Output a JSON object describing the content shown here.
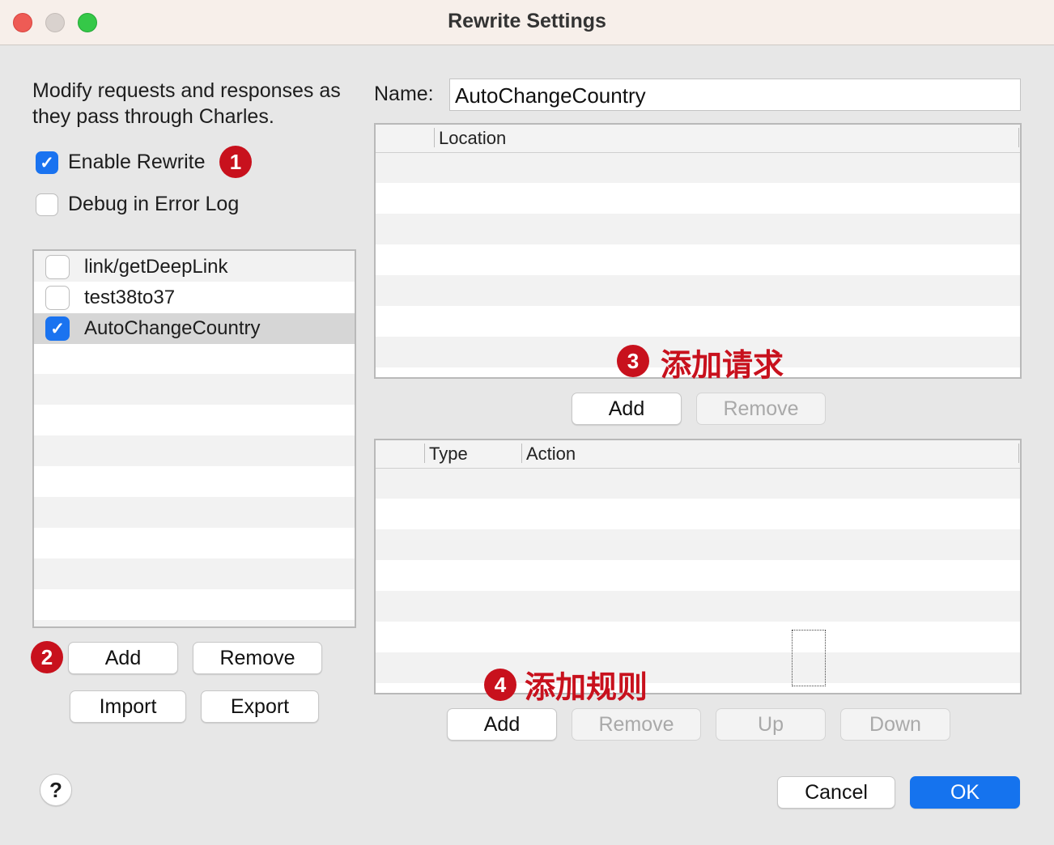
{
  "window": {
    "title": "Rewrite Settings"
  },
  "intro": {
    "text": "Modify requests and responses as they pass through Charles."
  },
  "options": {
    "enable_rewrite": {
      "label": "Enable Rewrite",
      "checked": true
    },
    "debug_log": {
      "label": "Debug in Error Log",
      "checked": false
    }
  },
  "rules": [
    {
      "label": "link/getDeepLink",
      "checked": false,
      "selected": false
    },
    {
      "label": "test38to37",
      "checked": false,
      "selected": false
    },
    {
      "label": "AutoChangeCountry",
      "checked": true,
      "selected": true
    }
  ],
  "rules_buttons": {
    "add": "Add",
    "remove": "Remove",
    "import": "Import",
    "export": "Export"
  },
  "name_field": {
    "label": "Name:",
    "value": "AutoChangeCountry"
  },
  "locations_table": {
    "columns": [
      "Location"
    ],
    "rows": []
  },
  "locations_buttons": {
    "add": "Add",
    "remove": "Remove"
  },
  "rules_table": {
    "columns": [
      "Type",
      "Action"
    ],
    "rows": []
  },
  "rules_table_buttons": {
    "add": "Add",
    "remove": "Remove",
    "up": "Up",
    "down": "Down"
  },
  "annotations": {
    "badge1": "1",
    "badge2": "2",
    "badge3": "3",
    "badge4": "4",
    "label3": "添加请求",
    "label4": "添加规则"
  },
  "footer": {
    "help": "?",
    "cancel": "Cancel",
    "ok": "OK"
  },
  "colors": {
    "accent": "#1573ee",
    "annotation": "#c8111d",
    "checkbox_on": "#1a73f0"
  },
  "icons": {
    "check": "checkmark-icon",
    "help": "question-icon"
  }
}
